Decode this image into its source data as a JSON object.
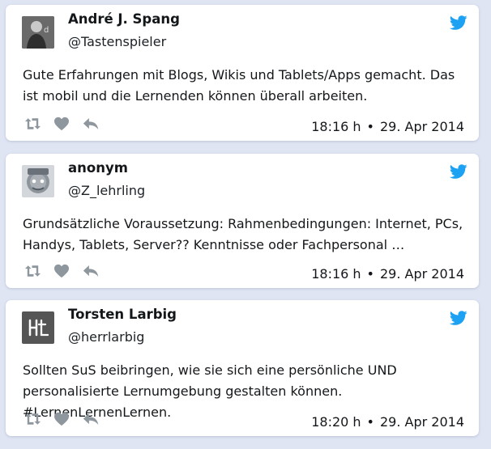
{
  "tweets": [
    {
      "author_name": "André J. Spang",
      "handle": "@Tastenspieler",
      "text": "Gute Erfahrungen mit Blogs, Wikis und Tablets/Apps gemacht. Das ist mobil und die Lernenden können überall arbeiten.",
      "time": "18:16 h",
      "separator": "•",
      "date": "29. Apr 2014",
      "avatar_icon": "photo-avatar-icon"
    },
    {
      "author_name": "anonym",
      "handle": "@Z_lehrling",
      "text": "Grundsätzliche Voraussetzung: Rahmenbedingungen: Internet, PCs, Handys, Tablets, Server?? Kenntnisse oder Fachpersonal …",
      "time": "18:16 h",
      "separator": "•",
      "date": "29. Apr 2014",
      "avatar_icon": "badge-avatar-icon"
    },
    {
      "author_name": "Torsten Larbig",
      "handle": "@herrlarbig",
      "text": "Sollten SuS beibringen, wie sie sich eine persönliche UND personalisierte Lernumgebung gestalten können. #LernenLernenLernen.",
      "time": "18:20 h",
      "separator": "•",
      "date": "29. Apr 2014",
      "avatar_icon": "monogram-avatar-icon"
    }
  ],
  "icons": {
    "bird": "twitter-bird-icon",
    "retweet": "retweet-icon",
    "like": "heart-icon",
    "reply": "reply-icon"
  },
  "colors": {
    "background": "#dfe5f3",
    "card": "#ffffff",
    "text": "#14171a",
    "twitter_blue": "#1da1f2",
    "icon_gray": "#8e969e"
  }
}
